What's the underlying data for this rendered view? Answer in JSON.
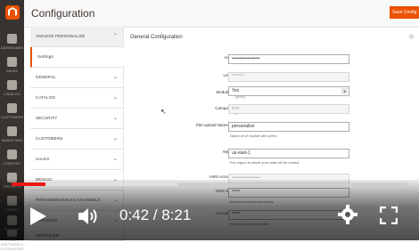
{
  "header": {
    "title": "Configuration",
    "save_label": "Save Config"
  },
  "sidebar": {
    "items": [
      {
        "icon": "dashboard-icon",
        "label": "DASHBOARD"
      },
      {
        "icon": "dollar-icon",
        "label": "SALES"
      },
      {
        "icon": "catalog-icon",
        "label": "CATALOG"
      },
      {
        "icon": "customers-icon",
        "label": "CUSTOMERS"
      },
      {
        "icon": "marketing-icon",
        "label": "MARKETING"
      },
      {
        "icon": "content-icon",
        "label": "CONTENT"
      },
      {
        "icon": "reports-icon",
        "label": "REPORTS"
      },
      {
        "icon": "stores-icon",
        "label": "STORES"
      },
      {
        "icon": "system-icon",
        "label": "SYSTEM"
      },
      {
        "icon": "extensions-icon",
        "label": "FIND PARTNERS & EXTENSIONS"
      }
    ]
  },
  "sections": [
    {
      "label": "AMAZON PERSONALIZE"
    },
    {
      "label": "Settings"
    },
    {
      "label": "GENERAL"
    },
    {
      "label": "CATALOG"
    },
    {
      "label": "SECURITY"
    },
    {
      "label": "CUSTOMERS"
    },
    {
      "label": "SALES"
    },
    {
      "label": "MOSAIC"
    },
    {
      "label": "PROVIDERS/SALES CHANNELS"
    },
    {
      "label": "SERVICES"
    },
    {
      "label": "ADVANCED"
    }
  ],
  "main": {
    "title": "General Configuration",
    "rows": [
      {
        "label": "Access Key",
        "scope": "[global]",
        "value": "••••••••••••••••••"
      },
      {
        "label": "License Key",
        "scope": "[global]",
        "value": "*******"
      },
      {
        "label": "Module Enabled",
        "scope": "[global]",
        "value": "Yes"
      },
      {
        "label": "Campaign Name",
        "scope": "[global]",
        "value": "test"
      },
      {
        "label": "File Upload Name Directory",
        "scope": "[global]",
        "value": "personalize",
        "note": "Name of s3 bucket with prefix"
      },
      {
        "label": "AWS Region",
        "scope": "[global]",
        "value": "us-east-1",
        "note": "Pre-region in which your data will be hosted"
      },
      {
        "label": "AWS Access Key ID",
        "scope": "[global]",
        "value": "••••••••••••••••••"
      },
      {
        "label": "AWS Secret Key",
        "scope": "[global]",
        "value": "*****",
        "note": "Amazon account secret key"
      },
      {
        "label": "Account Number",
        "scope": "[global]",
        "value": "*****",
        "note": "Amazon account number"
      }
    ]
  },
  "player": {
    "time": "0:42 / 8:21",
    "progress": 0.085,
    "buffered": 0.42,
    "accent": "#e91916"
  }
}
